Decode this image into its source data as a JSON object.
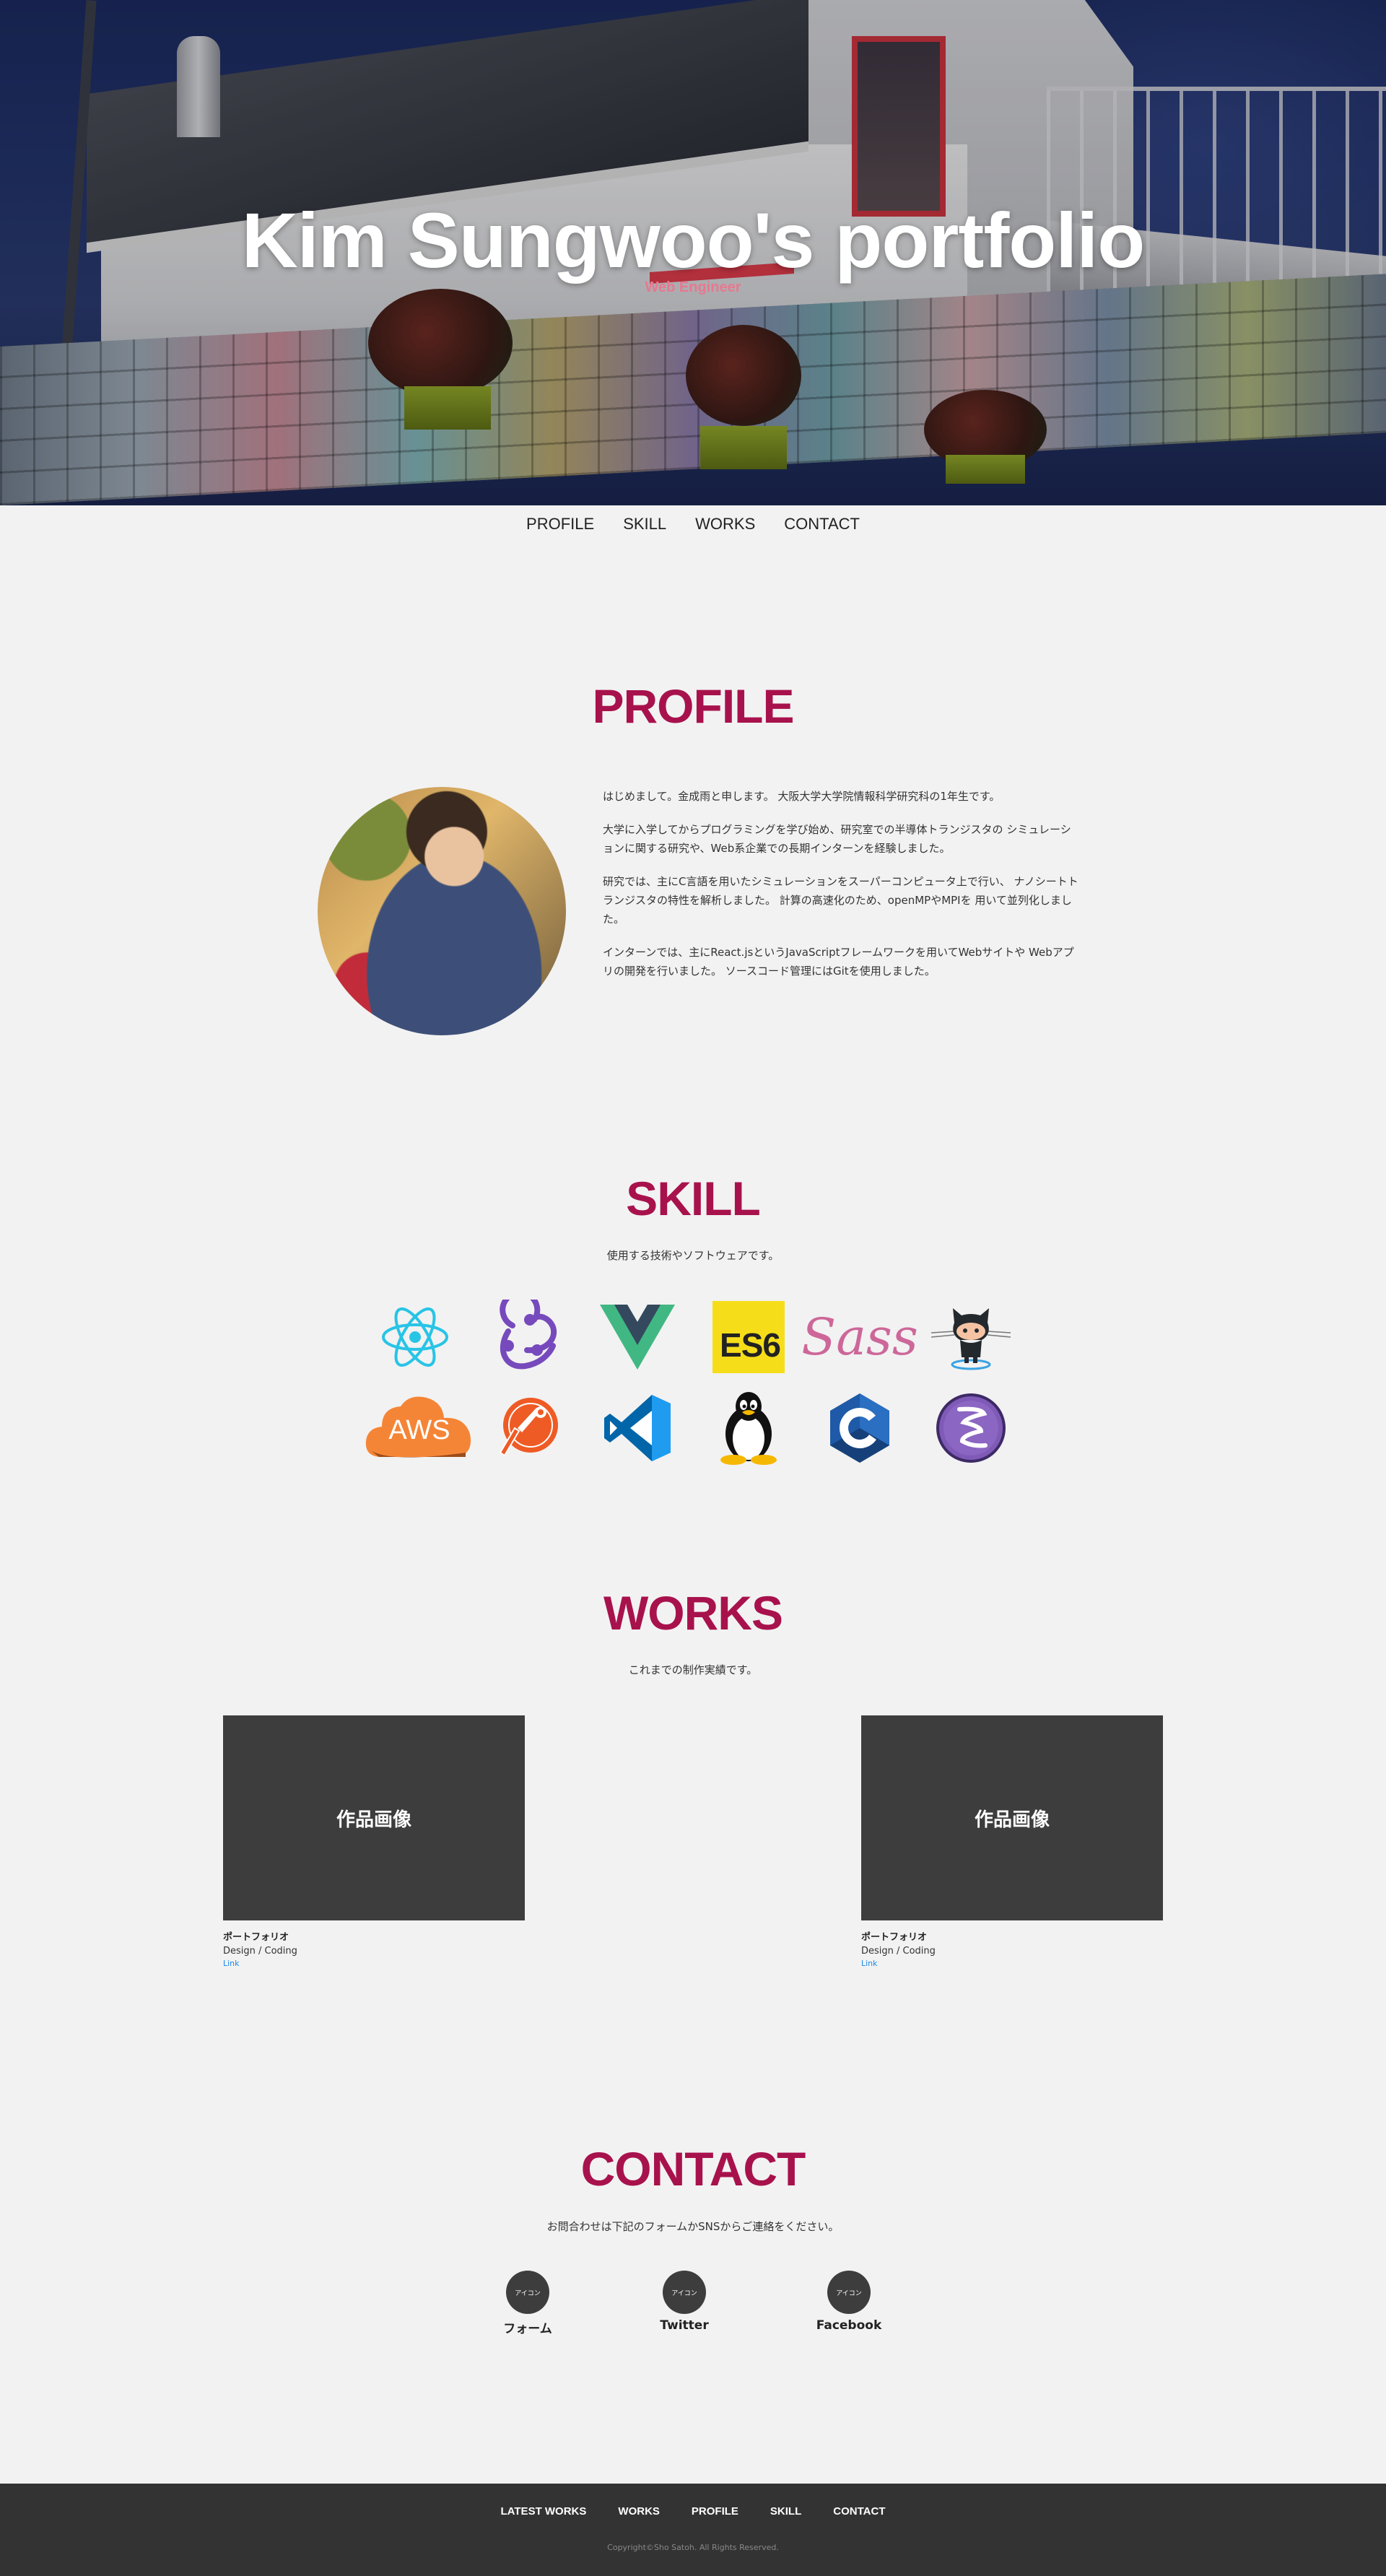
{
  "hero": {
    "title": "Kim Sungwoo's portfolio",
    "subtitle": "Web Engineer"
  },
  "nav": [
    "PROFILE",
    "SKILL",
    "WORKS",
    "CONTACT"
  ],
  "profile": {
    "heading": "PROFILE",
    "paragraphs": [
      "はじめまして。金成雨と申します。 大阪大学大学院情報科学研究科の1年生です。",
      "大学に入学してからプログラミングを学び始め、研究室での半導体トランジスタの シミュレーションに関する研究や、Web系企業での長期インターンを経験しました。",
      "研究では、主にC言語を用いたシミュレーションをスーパーコンピュータ上で行い、 ナノシートトランジスタの特性を解析しました。 計算の高速化のため、openMPやMPIを 用いて並列化しました。",
      "インターンでは、主にReact.jsというJavaScriptフレームワークを用いてWebサイトや Webアプリの開発を行いました。 ソースコード管理にはGitを使用しました。"
    ]
  },
  "skill": {
    "heading": "SKILL",
    "description": "使用する技術やソフトウェアです。",
    "icons": [
      "react-icon",
      "redux-icon",
      "vue-icon",
      "es6-icon",
      "sass-icon",
      "github-octocat-icon",
      "aws-icon",
      "postman-icon",
      "vscode-icon",
      "linux-tux-icon",
      "c-language-icon",
      "emacs-icon"
    ],
    "es6_label": "ES6",
    "sass_label": "Sass",
    "aws_label": "AWS",
    "colors": {
      "react": "#28c4e6",
      "redux": "#764abc",
      "vue_outer": "#41b883",
      "vue_inner": "#34495e",
      "es6": "#f5de19",
      "sass": "#cd6799",
      "aws": "#f58536",
      "postman": "#ef5b25",
      "vscode": "#0065a9",
      "c": "#283593",
      "emacs": "#7f5ab6"
    }
  },
  "works": {
    "heading": "WORKS",
    "description": "これまでの制作実績です。",
    "items": [
      {
        "thumb": "作品画像",
        "name": "ポートフォリオ",
        "role": "Design / Coding",
        "link": "Link"
      },
      {
        "thumb": "作品画像",
        "name": "ポートフォリオ",
        "role": "Design / Coding",
        "link": "Link"
      }
    ]
  },
  "contact": {
    "heading": "CONTACT",
    "description": "お問合わせは下記のフォームかSNSからご連絡をください。",
    "items": [
      {
        "icon": "アイコン",
        "label": "フォーム"
      },
      {
        "icon": "アイコン",
        "label": "Twitter"
      },
      {
        "icon": "アイコン",
        "label": "Facebook"
      }
    ]
  },
  "footer": {
    "nav": [
      "LATEST WORKS",
      "WORKS",
      "PROFILE",
      "SKILL",
      "CONTACT"
    ],
    "copyright": "Copyright©Sho Satoh. All Rights Reserved."
  },
  "colors": {
    "accent": "#a8124c",
    "subtitle": "#e87890",
    "footer_bg": "#333333",
    "page_bg": "#f2f2f2",
    "card_bg": "#3d3d3d",
    "link": "#1e88e5"
  }
}
